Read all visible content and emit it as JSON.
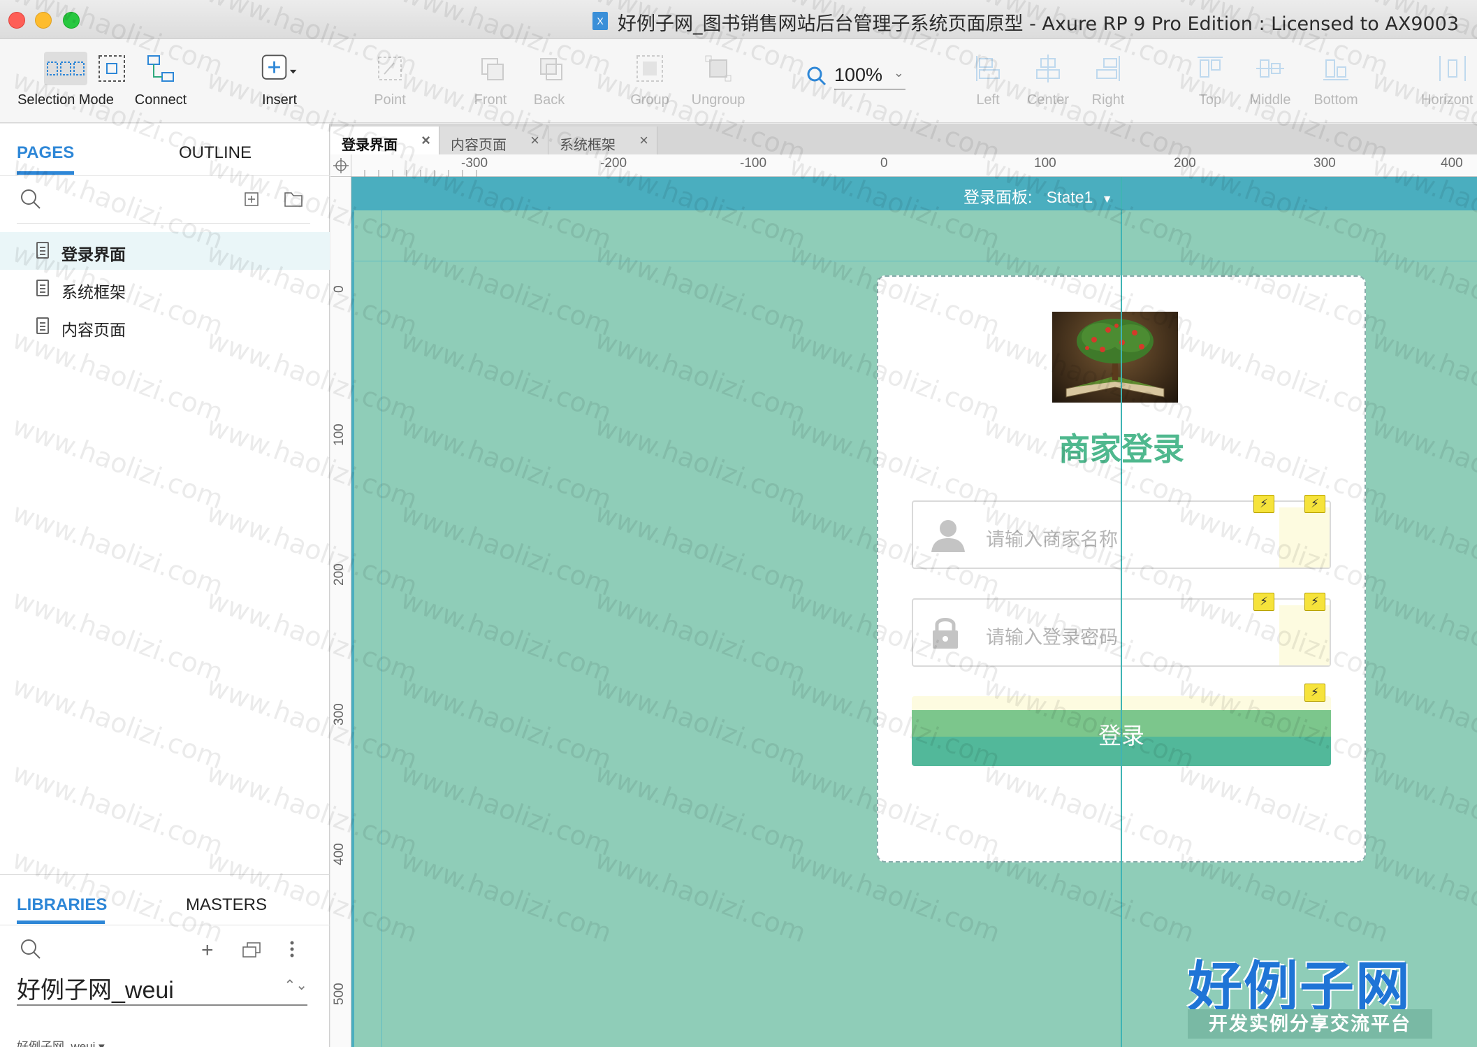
{
  "window": {
    "title": "好例子网_图书销售网站后台管理子系统页面原型 - Axure RP 9 Pro Edition : Licensed to AX9003"
  },
  "toolbar": {
    "selection_mode": "Selection Mode",
    "connect": "Connect",
    "insert": "Insert",
    "point": "Point",
    "front": "Front",
    "back": "Back",
    "group": "Group",
    "ungroup": "Ungroup",
    "zoom": "100%",
    "left": "Left",
    "center": "Center",
    "right": "Right",
    "top": "Top",
    "middle": "Middle",
    "bottom": "Bottom",
    "horizontal": "Horizont"
  },
  "left_panel": {
    "tabs": [
      "PAGES",
      "OUTLINE"
    ],
    "pages": [
      "登录界面",
      "系统框架",
      "内容页面"
    ],
    "lib_tabs": [
      "LIBRARIES",
      "MASTERS"
    ],
    "library_name": "好例子网_weui",
    "library_sub": "好例子网_weui ▾"
  },
  "doc_tabs": [
    "登录界面",
    "内容页面",
    "系统框架"
  ],
  "ruler": {
    "h_labels": [
      "-300",
      "-200",
      "-100",
      "0",
      "100",
      "200",
      "300",
      "400"
    ],
    "v_labels": [
      "0",
      "100",
      "200",
      "300",
      "400",
      "500"
    ]
  },
  "canvas": {
    "state_label": "登录面板:",
    "state_value": "State1",
    "card_title": "商家登录",
    "username_placeholder": "请输入商家名称",
    "password_placeholder": "请输入登录密码",
    "login_button": "登录"
  },
  "watermark": {
    "text": "www.haolizi.com",
    "brand": "好例子网",
    "brand_sub": "开发实例分享交流平台"
  },
  "colors": {
    "accent": "#2e87d7",
    "canvas_bg": "#8fcdb8",
    "state_bar": "#4aaebf",
    "title_green": "#4fb88e",
    "button_green": "#52b89a"
  }
}
